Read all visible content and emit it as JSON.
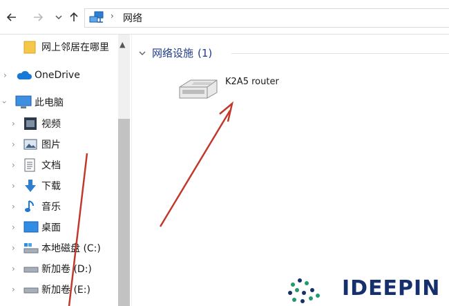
{
  "address_bar": {
    "back_icon": "arrow-left-icon",
    "forward_icon": "arrow-right-icon",
    "recent_icon": "chevron-down-icon",
    "up_icon": "arrow-up-icon",
    "location_icon": "network-icon",
    "path": "网络"
  },
  "sidebar": {
    "pinned": {
      "label": "网上邻居在哪里",
      "icon": "folder-icon"
    },
    "onedrive": {
      "label": "OneDrive",
      "icon": "cloud-icon"
    },
    "this_pc": {
      "label": "此电脑",
      "icon": "computer-icon"
    },
    "items": [
      {
        "label": "视频",
        "icon": "video-icon"
      },
      {
        "label": "图片",
        "icon": "picture-icon"
      },
      {
        "label": "文档",
        "icon": "document-icon"
      },
      {
        "label": "下载",
        "icon": "download-icon"
      },
      {
        "label": "音乐",
        "icon": "music-icon"
      },
      {
        "label": "桌面",
        "icon": "desktop-icon"
      },
      {
        "label": "本地磁盘 (C:)",
        "icon": "drive-icon"
      },
      {
        "label": "新加卷 (D:)",
        "icon": "drive-icon"
      },
      {
        "label": "新加卷 (E:)",
        "icon": "drive-icon"
      }
    ]
  },
  "main": {
    "group": {
      "title": "网络设施",
      "count": "(1)"
    },
    "devices": [
      {
        "label": "K2A5 router",
        "icon": "router-icon"
      }
    ]
  },
  "watermark": {
    "text": "IDEEPIN"
  },
  "colors": {
    "accent": "#1e3a8a",
    "annotation": "#c0392b"
  }
}
